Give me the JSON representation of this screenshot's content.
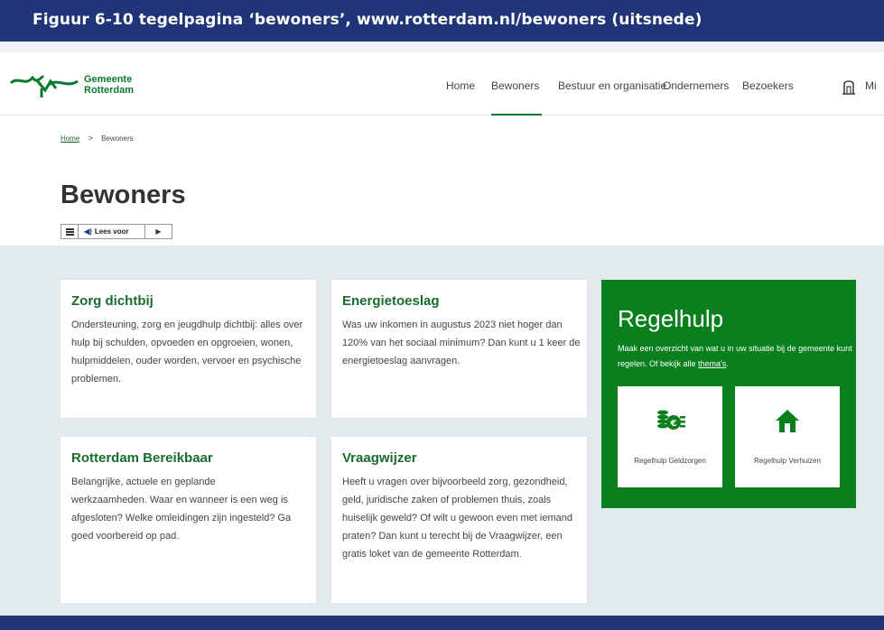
{
  "figure": {
    "caption": "Figuur 6-10 tegelpagina ‘bewoners’, www.rotterdam.nl/bewoners (uitsnede)"
  },
  "header": {
    "logo_line1": "Gemeente",
    "logo_line2": "Rotterdam",
    "nav": [
      "Home",
      "Bewoners",
      "Bestuur en organisatie",
      "Ondernemers",
      "Bezoekers"
    ],
    "nav_more": "Mi",
    "active_nav": "Bewoners"
  },
  "breadcrumb": {
    "home": "Home",
    "separator": ">",
    "current": "Bewoners"
  },
  "page_title": "Bewoners",
  "reader": {
    "label": "Lees voor"
  },
  "cards": [
    {
      "title": "Zorg dichtbij",
      "text": "Ondersteuning, zorg en jeugdhulp dichtbij: alles over hulp bij schulden, opvoeden en opgroeien, wonen, hulpmiddelen, ouder worden, vervoer en psychische problemen."
    },
    {
      "title": "Energietoeslag",
      "text": "Was uw inkomen in augustus 2023 niet hoger dan 120% van het sociaal minimum? Dan kunt u 1 keer de energietoeslag aanvragen."
    },
    {
      "title": "Rotterdam Bereikbaar",
      "text": "Belangrijke, actuele en geplande werkzaamheden. Waar en wanneer is een weg is afgesloten? Welke omleidingen zijn ingesteld? Ga goed voorbereid op pad."
    },
    {
      "title": "Vraagwijzer",
      "text": "Heeft u vragen over bijvoorbeeld zorg, gezondheid, geld, juridische zaken of problemen thuis, zoals huiselijk geweld? Of wilt u gewoon even met iemand praten? Dan kunt u terecht bij de Vraagwijzer, een gratis loket van de gemeente Rotterdam."
    }
  ],
  "regelhulp": {
    "title": "Regelhulp",
    "text": "Maak een overzicht van wat u in uw situatie bij de gemeente kunt regelen. Of bekijk alle ",
    "link": "thema's",
    "text_end": ".",
    "tiles": [
      {
        "label": "Regelhulp Geldzorgen",
        "icon": "money-icon"
      },
      {
        "label": "Regelhulp Verhuizen",
        "icon": "house-icon"
      }
    ]
  },
  "colors": {
    "caption_bg": "#1f3578",
    "brand_green": "#0a7f1e",
    "link_green": "#1a6b2f",
    "content_bg": "#e3ebee"
  }
}
